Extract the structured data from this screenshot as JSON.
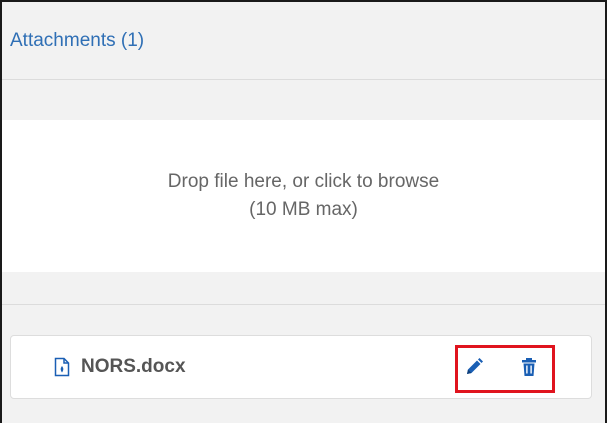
{
  "attachments": {
    "header_title": "Attachments (1)",
    "dropzone": {
      "line1": "Drop file here, or click to browse",
      "line2": "(10 MB max)"
    },
    "files": [
      {
        "name": "NORS.docx",
        "icon": "document-file-icon",
        "actions": [
          {
            "icon": "pencil-edit-icon"
          },
          {
            "icon": "trash-delete-icon"
          }
        ]
      }
    ],
    "highlight_color": "#e0141e",
    "link_color": "#2f6fb5",
    "action_icon_color": "#1a5fb4"
  }
}
